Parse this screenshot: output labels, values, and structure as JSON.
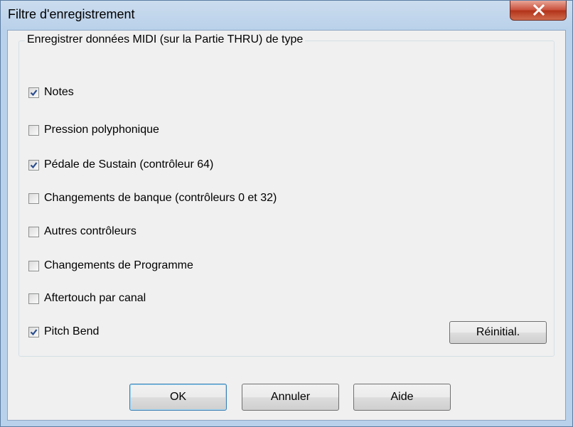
{
  "window": {
    "title": "Filtre d'enregistrement"
  },
  "group": {
    "label": "Enregistrer données MIDI (sur la Partie THRU) de type"
  },
  "checkboxes": [
    {
      "label": "Notes",
      "checked": true
    },
    {
      "label": "Pression polyphonique",
      "checked": false
    },
    {
      "label": "Pédale de Sustain (contrôleur 64)",
      "checked": true
    },
    {
      "label": "Changements de banque (contrôleurs 0 et 32)",
      "checked": false
    },
    {
      "label": "Autres contrôleurs",
      "checked": false
    },
    {
      "label": "Changements de Programme",
      "checked": false
    },
    {
      "label": "Aftertouch par canal",
      "checked": false
    },
    {
      "label": "Pitch Bend",
      "checked": true
    }
  ],
  "buttons": {
    "reset": "Réinitial.",
    "ok": "OK",
    "cancel": "Annuler",
    "help": "Aide"
  },
  "icons": {
    "close": "close-x-icon",
    "check": "checkmark-icon"
  },
  "colors": {
    "check": "#2a4d8f",
    "close_button": "#c9503c",
    "default_button_border": "#3c7fb1"
  }
}
